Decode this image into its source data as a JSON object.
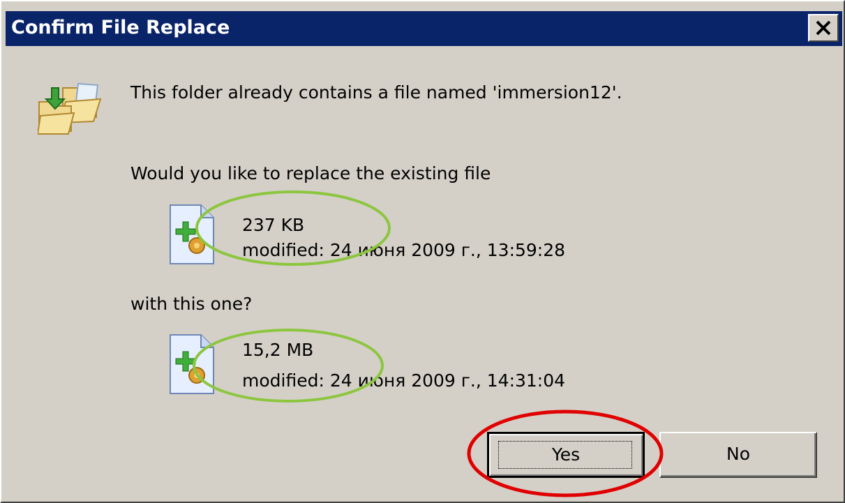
{
  "window": {
    "title": "Confirm File Replace"
  },
  "message": {
    "line1": "This folder already contains a file named 'immersion12'.",
    "question": "Would you like to replace the existing file",
    "with_text": "with this one?"
  },
  "existing_file": {
    "size": "237 KB",
    "modified": "modified: 24 июня 2009 г., 13:59:28"
  },
  "new_file": {
    "size": "15,2 MB",
    "modified": "modified: 24 июня 2009 г., 14:31:04"
  },
  "buttons": {
    "yes": "Yes",
    "no": "No"
  },
  "icons": {
    "dialog": "folder-move-icon",
    "file": "file-icon",
    "close": "close-icon"
  },
  "colors": {
    "titlebar": "#0a246a",
    "dialog_bg": "#d4d0c8",
    "annotation_green": "#8cc63f",
    "annotation_red": "#e00000"
  }
}
